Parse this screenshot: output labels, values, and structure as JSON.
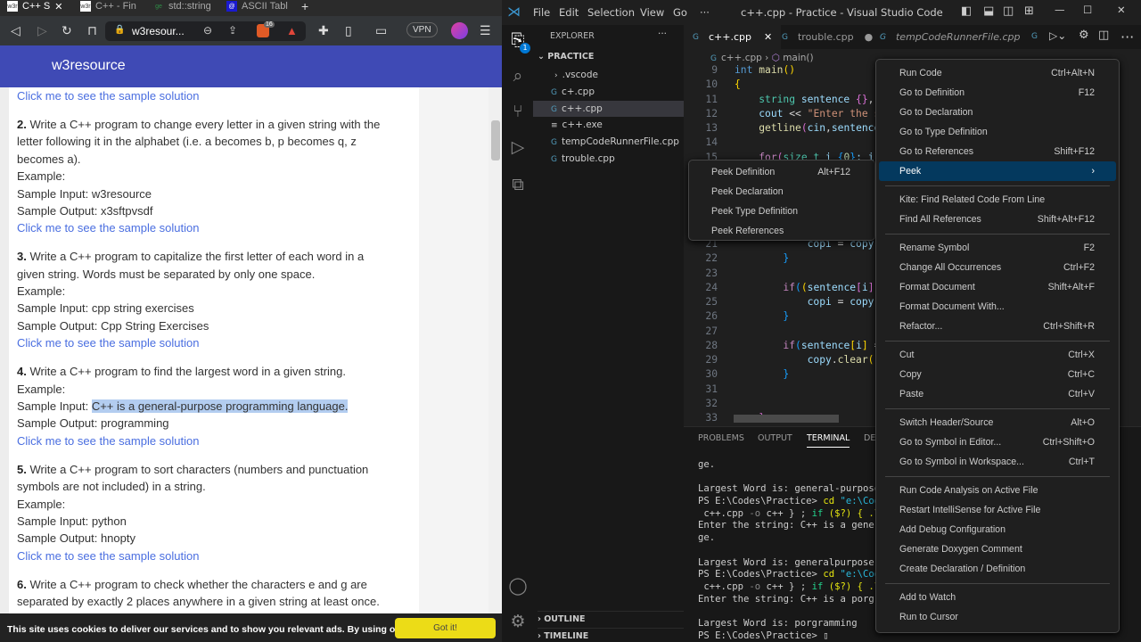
{
  "browser": {
    "tabs": [
      {
        "icon": "w3r",
        "label": "C++ S",
        "active": true
      },
      {
        "icon": "w3r",
        "label": "C++ - Fin"
      },
      {
        "icon": "ge",
        "label": "std::string"
      },
      {
        "icon": "@",
        "label": "ASCII Tabl"
      }
    ],
    "new_tab": "+",
    "url": "w3resour...",
    "brave_badge": "16",
    "vpn": "VPN",
    "site_name": "w3resource",
    "content": [
      {
        "type": "link",
        "text": "Click me to see the sample solution"
      },
      {
        "num": "2.",
        "lines": [
          " Write a C++ program to change every letter in a given string with the",
          "letter following it in the alphabet (i.e. a becomes b, p becomes q, z",
          "becomes a)."
        ],
        "example": "Example:",
        "input_label": "Sample Input: ",
        "input": "w3resource",
        "output": "Sample Output: x3sftpvsdf",
        "link": "Click me to see the sample solution"
      },
      {
        "num": "3.",
        "lines": [
          " Write a C++ program to capitalize the first letter of each word in a",
          "given string. Words must be separated by only one space."
        ],
        "example": "Example:",
        "input_label": "Sample Input: ",
        "input": "cpp string exercises",
        "output": "Sample Output: Cpp String Exercises",
        "link": "Click me to see the sample solution"
      },
      {
        "num": "4.",
        "lines": [
          " Write a C++ program to find the largest word in a given string."
        ],
        "example": "Example:",
        "input_label": "Sample Input: ",
        "input": "C++ is a general-purpose programming language.",
        "highlight": true,
        "output": "Sample Output: programming",
        "link": "Click me to see the sample solution"
      },
      {
        "num": "5.",
        "lines": [
          " Write a C++ program to sort characters (numbers and punctuation",
          "symbols are not included) in a string."
        ],
        "example": "Example:",
        "input_label": "Sample Input: ",
        "input": "python",
        "output": "Sample Output: hnopty",
        "link": "Click me to see the sample solution"
      },
      {
        "num": "6.",
        "lines": [
          " Write a C++ program to check whether the characters e and g are",
          "separated by exactly 2 places anywhere in a given string at least once."
        ]
      }
    ],
    "cookie_text": "This site uses cookies to deliver our services and to show you relevant ads. By using our site, you",
    "cookie_button": "Got it!"
  },
  "vscode": {
    "menus": [
      "File",
      "Edit",
      "Selection",
      "View",
      "Go",
      "···"
    ],
    "title": "c++.cpp - Practice - Visual Studio Code",
    "explorer_title": "EXPLORER",
    "explorer_more": "···",
    "badge": "1",
    "folder": "PRACTICE",
    "files": [
      {
        "name": ".vscode",
        "kind": "folder"
      },
      {
        "name": "c+.cpp",
        "kind": "cpp"
      },
      {
        "name": "c++.cpp",
        "kind": "cpp",
        "selected": true
      },
      {
        "name": "c++.exe",
        "kind": "exe"
      },
      {
        "name": "tempCodeRunnerFile.cpp",
        "kind": "cpp"
      },
      {
        "name": "trouble.cpp",
        "kind": "cpp"
      }
    ],
    "outline": "OUTLINE",
    "timeline": "TIMELINE",
    "tabs": [
      {
        "label": "c++.cpp",
        "state": "close"
      },
      {
        "label": "trouble.cpp",
        "state": "modified"
      },
      {
        "label": "tempCodeRunnerFile.cpp",
        "state": "preview"
      }
    ],
    "breadcrumb": {
      "file": "c++.cpp",
      "symbol": "main()"
    },
    "code": [
      {
        "n": "9",
        "t": [
          [
            "int ",
            "kw"
          ],
          [
            "main",
            "fn"
          ],
          [
            "()",
            "b1"
          ]
        ]
      },
      {
        "n": "10",
        "t": [
          [
            "{",
            "b1"
          ]
        ]
      },
      {
        "n": "11",
        "t": [
          [
            "    "
          ],
          [
            "string ",
            "ty"
          ],
          [
            "sentence ",
            "va"
          ],
          [
            "{}",
            "b2"
          ],
          [
            ", ",
            "op"
          ]
        ]
      },
      {
        "n": "12",
        "t": [
          [
            "    "
          ],
          [
            "cout ",
            "va"
          ],
          [
            "<< ",
            "op"
          ],
          [
            "\"Enter the s",
            "st"
          ]
        ]
      },
      {
        "n": "13",
        "t": [
          [
            "    "
          ],
          [
            "getline",
            "fn"
          ],
          [
            "(",
            "b2"
          ],
          [
            "cin",
            "va"
          ],
          [
            ",",
            "op"
          ],
          [
            "sentence",
            "va"
          ]
        ]
      },
      {
        "n": "14",
        "t": []
      },
      {
        "n": "15",
        "t": [
          [
            "    "
          ],
          [
            "for",
            "cf"
          ],
          [
            "(",
            "b2"
          ],
          [
            "size_t ",
            "ty"
          ],
          [
            "i ",
            "va"
          ],
          [
            "{",
            "b3"
          ],
          [
            "0",
            "nm"
          ],
          [
            "}",
            "b3"
          ],
          [
            "; i",
            "va"
          ]
        ]
      },
      {
        "n": "16",
        "t": []
      },
      {
        "n": "17",
        "t": []
      },
      {
        "n": "18",
        "t": []
      },
      {
        "n": "19",
        "t": []
      },
      {
        "n": "20",
        "t": []
      },
      {
        "n": "21",
        "t": [
          [
            "            "
          ],
          [
            "copi ",
            "va"
          ],
          [
            "= ",
            "op"
          ],
          [
            "copy",
            "va"
          ],
          [
            ";",
            "op"
          ]
        ]
      },
      {
        "n": "22",
        "t": [
          [
            "        "
          ],
          [
            "}",
            "b3"
          ]
        ]
      },
      {
        "n": "23",
        "t": []
      },
      {
        "n": "24",
        "t": [
          [
            "        "
          ],
          [
            "if",
            "cf"
          ],
          [
            "(",
            "b3"
          ],
          [
            "(",
            "b1"
          ],
          [
            "sentence",
            "va"
          ],
          [
            "[",
            "b2"
          ],
          [
            "i",
            "va"
          ],
          [
            "]",
            "b2"
          ]
        ]
      },
      {
        "n": "25",
        "t": [
          [
            "            "
          ],
          [
            "copi ",
            "va"
          ],
          [
            "= ",
            "op"
          ],
          [
            "copy",
            "va"
          ],
          [
            ";",
            "op"
          ]
        ]
      },
      {
        "n": "26",
        "t": [
          [
            "        "
          ],
          [
            "}",
            "b3"
          ]
        ]
      },
      {
        "n": "27",
        "t": []
      },
      {
        "n": "28",
        "t": [
          [
            "        "
          ],
          [
            "if",
            "cf"
          ],
          [
            "(",
            "b3"
          ],
          [
            "sentence",
            "va"
          ],
          [
            "[",
            "b1"
          ],
          [
            "i",
            "va"
          ],
          [
            "] ",
            "b1"
          ],
          [
            "=",
            "op"
          ]
        ]
      },
      {
        "n": "29",
        "t": [
          [
            "            "
          ],
          [
            "copy",
            "va"
          ],
          [
            ".",
            "op"
          ],
          [
            "clear",
            "fn"
          ],
          [
            "()",
            "b1"
          ]
        ]
      },
      {
        "n": "30",
        "t": [
          [
            "        "
          ],
          [
            "}",
            "b3"
          ]
        ]
      },
      {
        "n": "31",
        "t": []
      },
      {
        "n": "32",
        "t": []
      },
      {
        "n": "33",
        "t": [
          [
            "    "
          ],
          [
            "}",
            "b2"
          ]
        ]
      }
    ],
    "panel_tabs": [
      "PROBLEMS",
      "OUTPUT",
      "TERMINAL",
      "DE"
    ],
    "terminal": [
      [
        [
          "ge."
        ]
      ],
      [
        [
          ""
        ]
      ],
      [
        [
          "Largest Word is: general-purpose"
        ]
      ],
      [
        [
          "PS E:\\Codes\\Practice> "
        ],
        [
          "cd ",
          "ty2"
        ],
        [
          "\"e:\\Cod",
          "tc"
        ]
      ],
      [
        [
          " c++.cpp "
        ],
        [
          "-o ",
          "tgr"
        ],
        [
          "c++ } ; "
        ],
        [
          "if ",
          "tg"
        ],
        [
          "($?) { .\\",
          "ty2"
        ]
      ],
      [
        [
          "Enter the string: C++ is a gener"
        ]
      ],
      [
        [
          "ge."
        ]
      ],
      [
        [
          ""
        ]
      ],
      [
        [
          "Largest Word is: generalpurpose"
        ]
      ],
      [
        [
          "PS E:\\Codes\\Practice> "
        ],
        [
          "cd ",
          "ty2"
        ],
        [
          "\"e:\\Cod",
          "tc"
        ]
      ],
      [
        [
          " c++.cpp "
        ],
        [
          "-o ",
          "tgr"
        ],
        [
          "c++ } ; "
        ],
        [
          "if ",
          "tg"
        ],
        [
          "($?) { .\\",
          "ty2"
        ]
      ],
      [
        [
          "Enter the string: C++ is a porgr"
        ]
      ],
      [
        [
          ""
        ]
      ],
      [
        [
          "Largest Word is: porgramming"
        ]
      ],
      [
        [
          "PS E:\\Codes\\Practice> "
        ],
        [
          "▯"
        ]
      ]
    ],
    "context_menu": [
      {
        "label": "Run Code",
        "key": "Ctrl+Alt+N"
      },
      {
        "label": "Go to Definition",
        "key": "F12"
      },
      {
        "label": "Go to Declaration",
        "key": ""
      },
      {
        "label": "Go to Type Definition",
        "key": ""
      },
      {
        "label": "Go to References",
        "key": "Shift+F12"
      },
      {
        "label": "Peek",
        "key": "›",
        "selected": true
      },
      {
        "sep": true
      },
      {
        "label": "Kite: Find Related Code From Line",
        "key": ""
      },
      {
        "label": "Find All References",
        "key": "Shift+Alt+F12"
      },
      {
        "sep": true
      },
      {
        "label": "Rename Symbol",
        "key": "F2"
      },
      {
        "label": "Change All Occurrences",
        "key": "Ctrl+F2"
      },
      {
        "label": "Format Document",
        "key": "Shift+Alt+F"
      },
      {
        "label": "Format Document With...",
        "key": ""
      },
      {
        "label": "Refactor...",
        "key": "Ctrl+Shift+R"
      },
      {
        "sep": true
      },
      {
        "label": "Cut",
        "key": "Ctrl+X"
      },
      {
        "label": "Copy",
        "key": "Ctrl+C"
      },
      {
        "label": "Paste",
        "key": "Ctrl+V"
      },
      {
        "sep": true
      },
      {
        "label": "Switch Header/Source",
        "key": "Alt+O"
      },
      {
        "label": "Go to Symbol in Editor...",
        "key": "Ctrl+Shift+O"
      },
      {
        "label": "Go to Symbol in Workspace...",
        "key": "Ctrl+T"
      },
      {
        "sep": true
      },
      {
        "label": "Run Code Analysis on Active File",
        "key": ""
      },
      {
        "label": "Restart IntelliSense for Active File",
        "key": ""
      },
      {
        "label": "Add Debug Configuration",
        "key": ""
      },
      {
        "label": "Generate Doxygen Comment",
        "key": ""
      },
      {
        "label": "Create Declaration / Definition",
        "key": ""
      },
      {
        "sep": true
      },
      {
        "label": "Add to Watch",
        "key": ""
      },
      {
        "label": "Run to Cursor",
        "key": ""
      }
    ],
    "peek_menu": [
      {
        "label": "Peek Definition",
        "key": "Alt+F12"
      },
      {
        "label": "Peek Declaration",
        "key": ""
      },
      {
        "label": "Peek Type Definition",
        "key": ""
      },
      {
        "label": "Peek References",
        "key": ""
      }
    ]
  }
}
